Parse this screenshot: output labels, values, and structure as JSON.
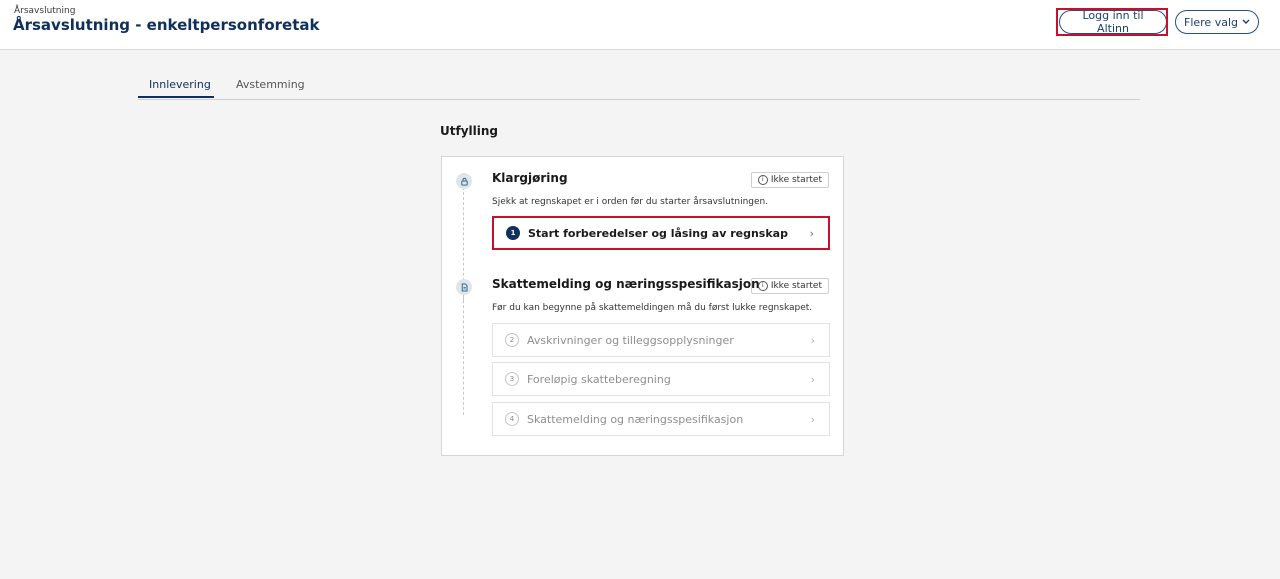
{
  "header": {
    "breadcrumb": "Årsavslutning",
    "title": "Årsavslutning - enkeltpersonforetak",
    "login_label": "Logg inn til Altinn",
    "more_label": "Flere valg"
  },
  "tabs": [
    {
      "label": "Innlevering",
      "active": true
    },
    {
      "label": "Avstemming",
      "active": false
    }
  ],
  "section": {
    "heading": "Utfylling"
  },
  "groups": [
    {
      "title": "Klargjøring",
      "status": "Ikke startet",
      "description": "Sjekk at regnskapet er i orden før du starter årsavslutningen.",
      "tasks": [
        {
          "number": "1",
          "label": "Start forberedelser og låsing av regnskap",
          "state": "active"
        }
      ]
    },
    {
      "title": "Skattemelding og næringsspesifikasjon",
      "status": "Ikke startet",
      "description": "Før du kan begynne på skattemeldingen må du først lukke regnskapet.",
      "tasks": [
        {
          "number": "2",
          "label": "Avskrivninger og tilleggsopplysninger",
          "state": "disabled"
        },
        {
          "number": "3",
          "label": "Foreløpig skatteberegning",
          "state": "disabled"
        },
        {
          "number": "4",
          "label": "Skattemelding og næringsspesifikasjon",
          "state": "disabled"
        }
      ]
    }
  ],
  "colors": {
    "brand": "#0f2f5c",
    "highlight": "#c8102e",
    "background": "#f4f4f4"
  },
  "icons": {
    "group1": "lock-icon",
    "group2": "document-icon",
    "status": "info-icon",
    "chevron": "chevron-right-icon",
    "more": "chevron-down-icon"
  }
}
